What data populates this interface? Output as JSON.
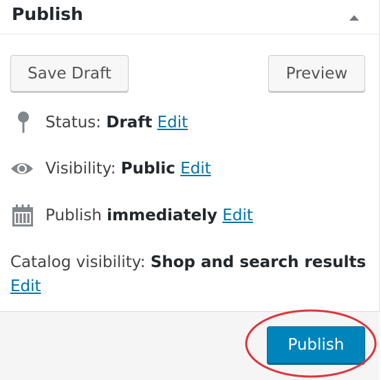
{
  "colors": {
    "accent": "#0085ba",
    "link": "#0073aa",
    "highlight_ring": "#e0343b"
  },
  "panel": {
    "title": "Publish",
    "toggle_icon": "caret-up-icon"
  },
  "actions": {
    "save_draft_label": "Save Draft",
    "preview_label": "Preview"
  },
  "status": {
    "icon": "pin-icon",
    "label": "Status:",
    "value": "Draft",
    "edit_label": "Edit"
  },
  "visibility": {
    "icon": "eye-icon",
    "label": "Visibility:",
    "value": "Public",
    "edit_label": "Edit"
  },
  "schedule": {
    "icon": "calendar-icon",
    "label": "Publish",
    "value": "immediately",
    "edit_label": "Edit"
  },
  "catalog": {
    "label": "Catalog visibility:",
    "value": "Shop and search results",
    "edit_label": "Edit"
  },
  "footer": {
    "publish_label": "Publish"
  }
}
